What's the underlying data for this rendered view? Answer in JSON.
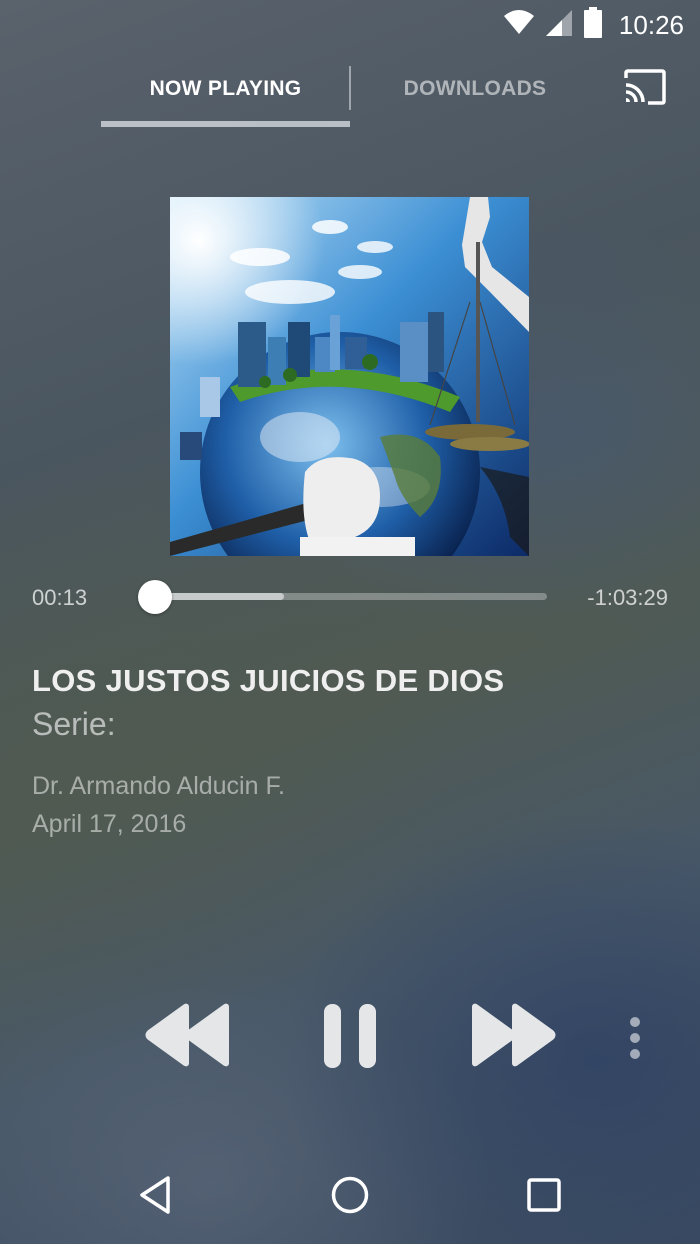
{
  "status_bar": {
    "time": "10:26",
    "icons": [
      "wifi-icon",
      "signal-icon",
      "battery-icon"
    ]
  },
  "tabs": {
    "now_playing": "NOW PLAYING",
    "downloads": "DOWNLOADS",
    "active": "now_playing"
  },
  "cast_icon": "cast-icon",
  "player": {
    "elapsed": "00:13",
    "remaining": "-1:03:29",
    "progress_fraction": 0.0,
    "buffered_fraction": 0.33
  },
  "track": {
    "title": "LOS JUSTOS JUICIOS DE DIOS",
    "series": "Serie:",
    "speaker": "Dr. Armando Alducin F.",
    "date": "April 17, 2016"
  },
  "controls": [
    "rewind-icon",
    "pause-icon",
    "fast-forward-icon",
    "more-vertical-icon"
  ],
  "navigation": [
    "back-icon",
    "home-icon",
    "recents-icon"
  ],
  "colors": {
    "text_primary": "#ffffff",
    "tab_indicator": "#dce1e6"
  }
}
